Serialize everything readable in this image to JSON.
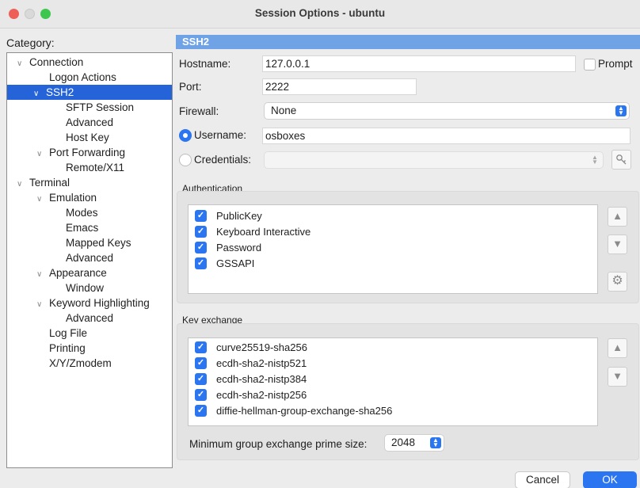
{
  "window": {
    "title": "Session Options - ubuntu"
  },
  "category": {
    "label": "Category:",
    "tree": [
      {
        "label": "Connection",
        "expanded": true
      },
      {
        "label": "Logon Actions"
      },
      {
        "label": "SSH2",
        "expanded": true,
        "selected": true
      },
      {
        "label": "SFTP Session"
      },
      {
        "label": "Advanced"
      },
      {
        "label": "Host Key"
      },
      {
        "label": "Port Forwarding",
        "expanded": true
      },
      {
        "label": "Remote/X11"
      },
      {
        "label": "Terminal",
        "expanded": true
      },
      {
        "label": "Emulation",
        "expanded": true
      },
      {
        "label": "Modes"
      },
      {
        "label": "Emacs"
      },
      {
        "label": "Mapped Keys"
      },
      {
        "label": "Advanced"
      },
      {
        "label": "Appearance",
        "expanded": true
      },
      {
        "label": "Window"
      },
      {
        "label": "Keyword Highlighting",
        "expanded": true
      },
      {
        "label": "Advanced"
      },
      {
        "label": "Log File"
      },
      {
        "label": "Printing"
      },
      {
        "label": "X/Y/Zmodem"
      }
    ]
  },
  "section": {
    "title": "SSH2"
  },
  "form": {
    "hostname_label": "Hostname:",
    "hostname_value": "127.0.0.1",
    "prompt_label": "Prompt",
    "prompt_checked": false,
    "port_label": "Port:",
    "port_value": "2222",
    "firewall_label": "Firewall:",
    "firewall_value": "None",
    "username_label": "Username:",
    "username_value": "osboxes",
    "username_selected": true,
    "credentials_label": "Credentials:",
    "credentials_value": ""
  },
  "authentication": {
    "label": "Authentication",
    "items": [
      {
        "label": "PublicKey",
        "checked": true
      },
      {
        "label": "Keyboard Interactive",
        "checked": true
      },
      {
        "label": "Password",
        "checked": true
      },
      {
        "label": "GSSAPI",
        "checked": true
      }
    ]
  },
  "key_exchange": {
    "label": "Key exchange",
    "items": [
      {
        "label": "curve25519-sha256",
        "checked": true
      },
      {
        "label": "ecdh-sha2-nistp521",
        "checked": true
      },
      {
        "label": "ecdh-sha2-nistp384",
        "checked": true
      },
      {
        "label": "ecdh-sha2-nistp256",
        "checked": true
      },
      {
        "label": "diffie-hellman-group-exchange-sha256",
        "checked": true
      }
    ],
    "min_prime_label": "Minimum group exchange prime size:",
    "min_prime_value": "2048"
  },
  "buttons": {
    "cancel": "Cancel",
    "ok": "OK"
  },
  "icons": {
    "up": "arrow-up-icon",
    "down": "arrow-down-icon",
    "gear": "gear-icon",
    "key": "key-icon",
    "chevron": "chevron-down-icon"
  },
  "colors": {
    "accent": "#2b75f0",
    "selection": "#2563d8",
    "section_header": "#6fa3e6"
  }
}
